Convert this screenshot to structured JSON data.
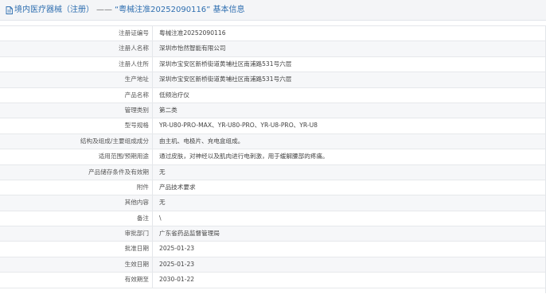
{
  "header": {
    "title_prefix": "境内医疗器械（注册）",
    "title_dash": "——",
    "title_main": "“粤械注准20252090116” 基本信息",
    "icon": "document-icon",
    "accent_color": "#2f6fb0"
  },
  "rows": [
    {
      "label": "注册证编号",
      "value": "粤械注准20252090116"
    },
    {
      "label": "注册人名称",
      "value": "深圳市怡然智能有限公司"
    },
    {
      "label": "注册人住所",
      "value": "深圳市宝安区新桥街道黄埔社区南浦路531号六层"
    },
    {
      "label": "生产地址",
      "value": "深圳市宝安区新桥街道黄埔社区南浦路531号六层"
    },
    {
      "label": "产品名称",
      "value": "低频治疗仪"
    },
    {
      "label": "管理类别",
      "value": "第二类"
    },
    {
      "label": "型号规格",
      "value": "YR-U80-PRO-MAX、YR-U80-PRO、YR-U8-PRO、YR-U8"
    },
    {
      "label": "结构及组成/主要组成成分",
      "value": "由主机、电极片、充电盒组成。"
    },
    {
      "label": "适用范围/预期用途",
      "value": "通过皮肤，对神经以及肌肉进行电刺激，用于缓解腰部的疼痛。"
    },
    {
      "label": "产品储存条件及有效期",
      "value": "无"
    },
    {
      "label": "附件",
      "value": "产品技术要求"
    },
    {
      "label": "其他内容",
      "value": "无"
    },
    {
      "label": "备注",
      "value": "\\"
    },
    {
      "label": "审批部门",
      "value": "广东省药品监督管理局"
    },
    {
      "label": "批准日期",
      "value": "2025-01-23"
    },
    {
      "label": "生效日期",
      "value": "2025-01-23"
    },
    {
      "label": "有效期至",
      "value": "2030-01-22"
    }
  ]
}
